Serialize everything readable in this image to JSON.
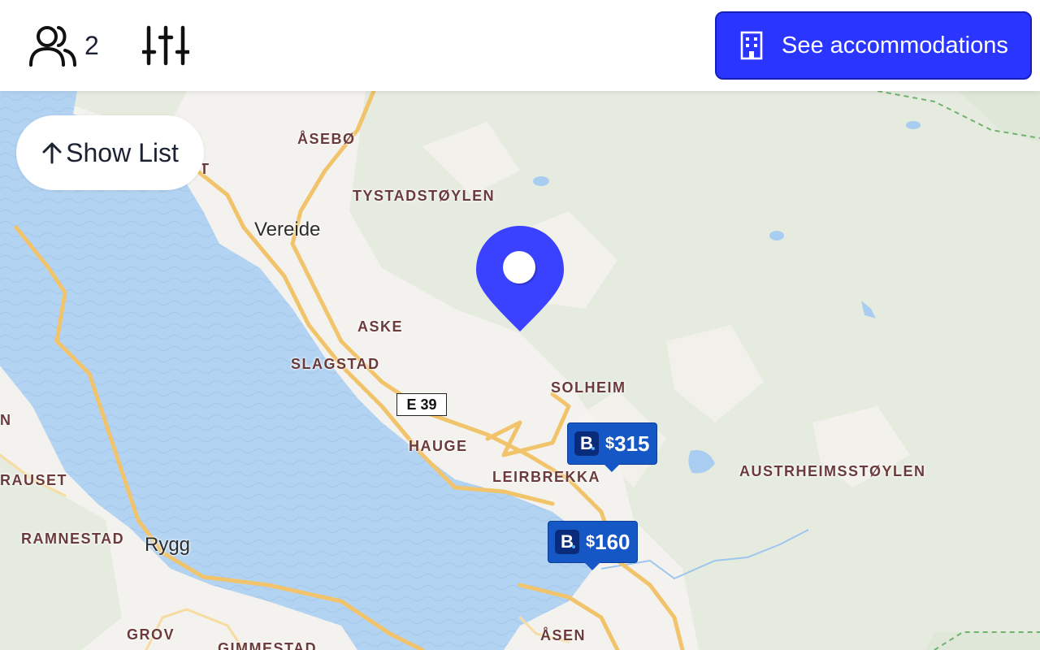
{
  "topbar": {
    "guests_count": "2",
    "see_accommodations_label": "See accommodations"
  },
  "map": {
    "show_list_label": "Show List",
    "road_shield": "E 39",
    "places": {
      "asebo": "ÅSEBØ",
      "tystadstoylen": "TYSTADSTØYLEN",
      "aske": "ASKE",
      "slagstad": "SLAGSTAD",
      "solheim": "SOLHEIM",
      "hauge": "HAUGE",
      "leirbrekka": "LEIRBREKKA",
      "austrheimsstoylen": "AUSTRHEIMSSTØYLEN",
      "rauset": "RAUSET",
      "ramnestad": "RAMNESTAD",
      "grov": "GROV",
      "gimmestad": "GIMMESTAD",
      "asen": "ÅSEN",
      "edge_n": "N",
      "edge_t": "T"
    },
    "towns": {
      "vereide": "Vereide",
      "rygg": "Rygg"
    },
    "price_markers": [
      {
        "logo": "B",
        "currency": "$",
        "amount": "315"
      },
      {
        "logo": "B",
        "currency": "$",
        "amount": "160"
      }
    ]
  },
  "colors": {
    "accent": "#2a36ff",
    "marker": "#1557c4",
    "water": "#b3d3f2",
    "road": "#f6cf76"
  },
  "icons": {
    "guests": "users-icon",
    "filters": "sliders-icon",
    "accommodation": "building-icon",
    "show_list": "arrow-up-icon",
    "pin": "location-pin-icon"
  }
}
